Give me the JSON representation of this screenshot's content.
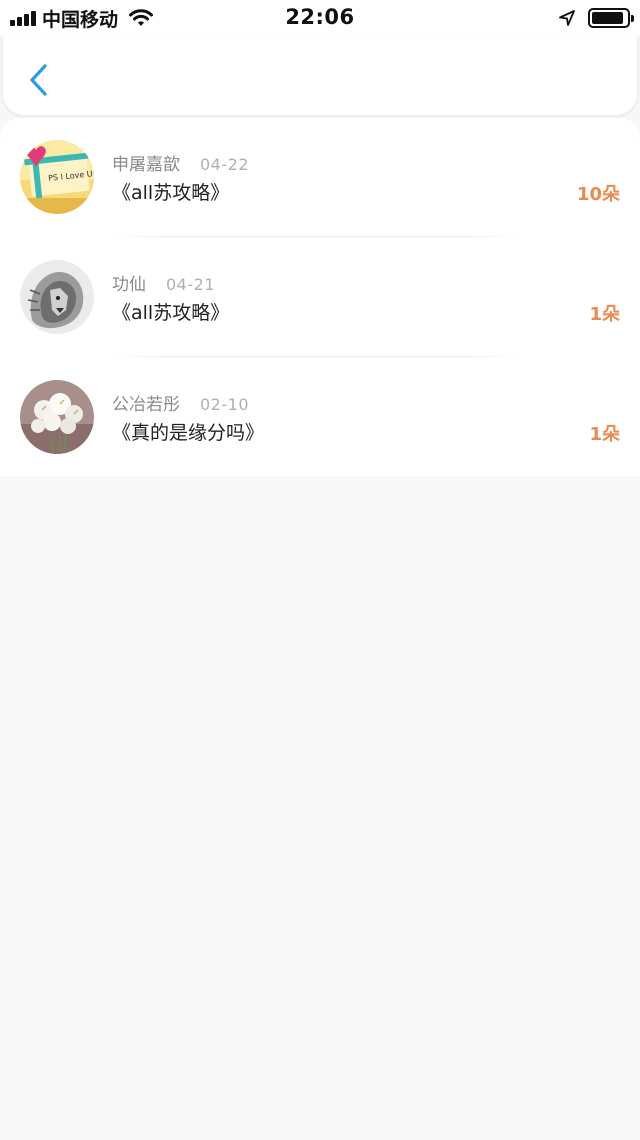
{
  "status_bar": {
    "carrier": "中国移动",
    "time": "22:06",
    "battery_level": 0.9
  },
  "nav": {
    "back_icon": "chevron-left-icon",
    "accent_color": "#2a9de2"
  },
  "records": [
    {
      "name": "申屠嘉歆",
      "date": "04-22",
      "title": "《all苏攻略》",
      "amount": "10朵",
      "avatar_text": "PS I Love U"
    },
    {
      "name": "功仙",
      "date": "04-21",
      "title": "《all苏攻略》",
      "amount": "1朵"
    },
    {
      "name": "公冶若彤",
      "date": "02-10",
      "title": "《真的是缘分吗》",
      "amount": "1朵"
    }
  ],
  "colors": {
    "amount": "#e98b4f",
    "name": "#8a8a8a",
    "date": "#b0b0b0",
    "title": "#222222",
    "page_bg": "#f8f6f7"
  }
}
